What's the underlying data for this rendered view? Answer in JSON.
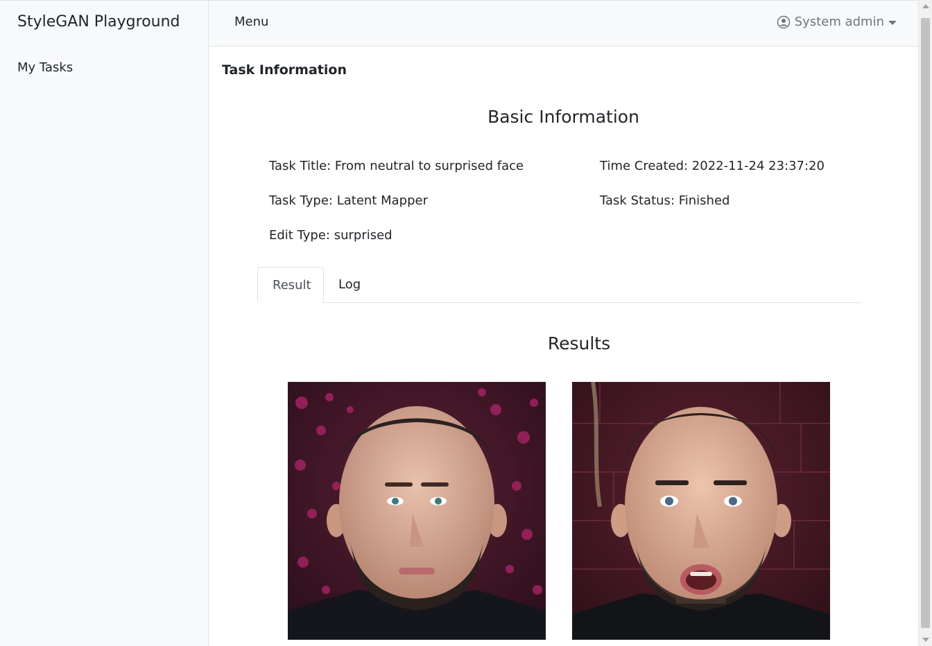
{
  "sidebar": {
    "brand": "StyleGAN Playground",
    "items": [
      {
        "label": "My Tasks"
      }
    ]
  },
  "topbar": {
    "menu_label": "Menu",
    "user_label": "System admin",
    "user_icon": "user-circle-icon"
  },
  "page": {
    "section_title": "Task Information",
    "basic_heading": "Basic Information"
  },
  "task": {
    "title": "Task Title: From neutral to surprised face",
    "type": "Task Type: Latent Mapper",
    "edit_type": "Edit Type: surprised",
    "time_created": "Time Created: 2022-11-24 23:37:20",
    "status": "Task Status: Finished"
  },
  "tabs": [
    {
      "label": "Result",
      "active": true
    },
    {
      "label": "Log",
      "active": false
    }
  ],
  "results": {
    "heading": "Results"
  }
}
